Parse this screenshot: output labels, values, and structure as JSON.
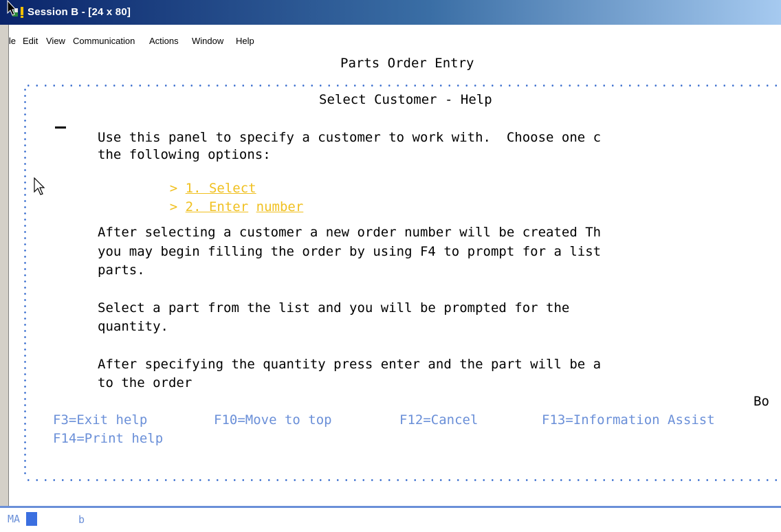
{
  "window": {
    "title": "Session B - [24 x 80]"
  },
  "menu": {
    "file": "File",
    "edit": "Edit",
    "view": "View",
    "communication": "Communication",
    "actions": "Actions",
    "window": "Window",
    "help": "Help"
  },
  "screen": {
    "app_title": "Parts Order Entry",
    "panel_title": "Select Customer - Help",
    "intro_line1": "Use this panel to specify a customer to work with.  Choose one c",
    "intro_line2": "the following options:",
    "option1_marker": ">",
    "option1_label": "1. Select",
    "option2_marker": ">",
    "option2_label_a": "2. Enter",
    "option2_label_b": "number",
    "para2_line1": "After selecting a customer a new order number will be created Th",
    "para2_line2": "you may begin filling the order by using F4 to prompt for a list",
    "para2_line3": "parts.",
    "para3_line1": "Select a part from the list and you will be prompted for the",
    "para3_line2": "quantity.",
    "para4_line1": "After specifying the quantity press enter and the part will be a",
    "para4_line2": "to the order",
    "more_indicator": "Bo",
    "fkeys": {
      "f3": "F3=Exit help",
      "f10": "F10=Move to top",
      "f12": "F12=Cancel",
      "f13": "F13=Information Assist",
      "f14": "F14=Print help"
    }
  },
  "status": {
    "indicator": "MA",
    "field": "b"
  },
  "colors": {
    "title_gradient_start": "#0a246a",
    "title_gradient_end": "#a6caf0",
    "highlight_yellow": "#f0c020",
    "function_key_blue": "#6a8fd8",
    "border_dots_blue": "#3b6fcf"
  }
}
